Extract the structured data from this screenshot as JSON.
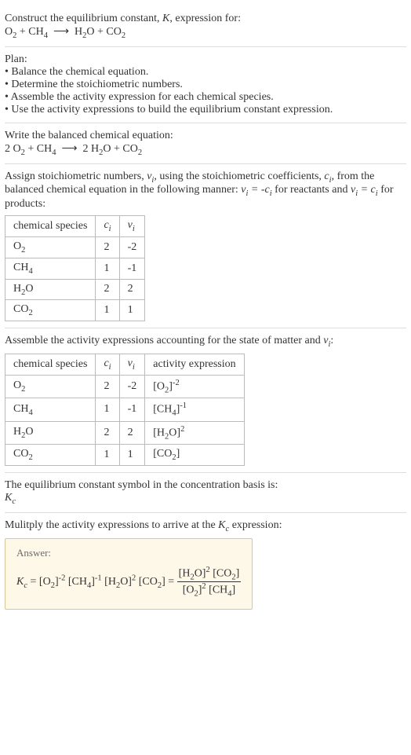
{
  "intro": {
    "line1_a": "Construct the equilibrium constant, ",
    "line1_k": "K",
    "line1_b": ", expression for:"
  },
  "plan": {
    "title": "Plan:",
    "b1": "• Balance the chemical equation.",
    "b2": "• Determine the stoichiometric numbers.",
    "b3": "• Assemble the activity expression for each chemical species.",
    "b4": "• Use the activity expressions to build the equilibrium constant expression."
  },
  "balance": {
    "line": "Write the balanced chemical equation:"
  },
  "stoich": {
    "p1a": "Assign stoichiometric numbers, ",
    "p1b": ", using the stoichiometric coefficients, ",
    "p1c": ", from the balanced chemical equation in the following manner: ",
    "p1d": " for reactants and ",
    "p1e": " for products:",
    "headers": {
      "h1": "chemical species"
    },
    "rows": [
      {
        "name": "O",
        "sub": "2",
        "c": "2",
        "v": "-2"
      },
      {
        "name": "CH",
        "sub": "4",
        "c": "1",
        "v": "-1"
      },
      {
        "name": "H",
        "sub": "2",
        "tail": "O",
        "c": "2",
        "v": "2"
      },
      {
        "name": "CO",
        "sub": "2",
        "c": "1",
        "v": "1"
      }
    ]
  },
  "activity": {
    "line_a": "Assemble the activity expressions accounting for the state of matter and ",
    "line_b": ":",
    "headers": {
      "h1": "chemical species",
      "h4": "activity expression"
    }
  },
  "konst": {
    "line": "The equilibrium constant symbol in the concentration basis is:"
  },
  "mult": {
    "line_a": "Mulitply the activity expressions to arrive at the ",
    "line_b": " expression:"
  },
  "answer": {
    "label": "Answer:"
  },
  "chart_data": {
    "type": "table",
    "tables": [
      {
        "title": "stoichiometric numbers",
        "columns": [
          "chemical species",
          "c_i",
          "ν_i"
        ],
        "rows": [
          [
            "O2",
            2,
            -2
          ],
          [
            "CH4",
            1,
            -1
          ],
          [
            "H2O",
            2,
            2
          ],
          [
            "CO2",
            1,
            1
          ]
        ]
      },
      {
        "title": "activity expressions",
        "columns": [
          "chemical species",
          "c_i",
          "ν_i",
          "activity expression"
        ],
        "rows": [
          [
            "O2",
            2,
            -2,
            "[O2]^-2"
          ],
          [
            "CH4",
            1,
            -1,
            "[CH4]^-1"
          ],
          [
            "H2O",
            2,
            2,
            "[H2O]^2"
          ],
          [
            "CO2",
            1,
            1,
            "[CO2]"
          ]
        ]
      }
    ],
    "unbalanced_equation": "O2 + CH4 ⟶ H2O + CO2",
    "balanced_equation": "2 O2 + CH4 ⟶ 2 H2O + CO2",
    "equilibrium_expression": "K_c = [O2]^-2 [CH4]^-1 [H2O]^2 [CO2] = ([H2O]^2 [CO2]) / ([O2]^2 [CH4])"
  }
}
